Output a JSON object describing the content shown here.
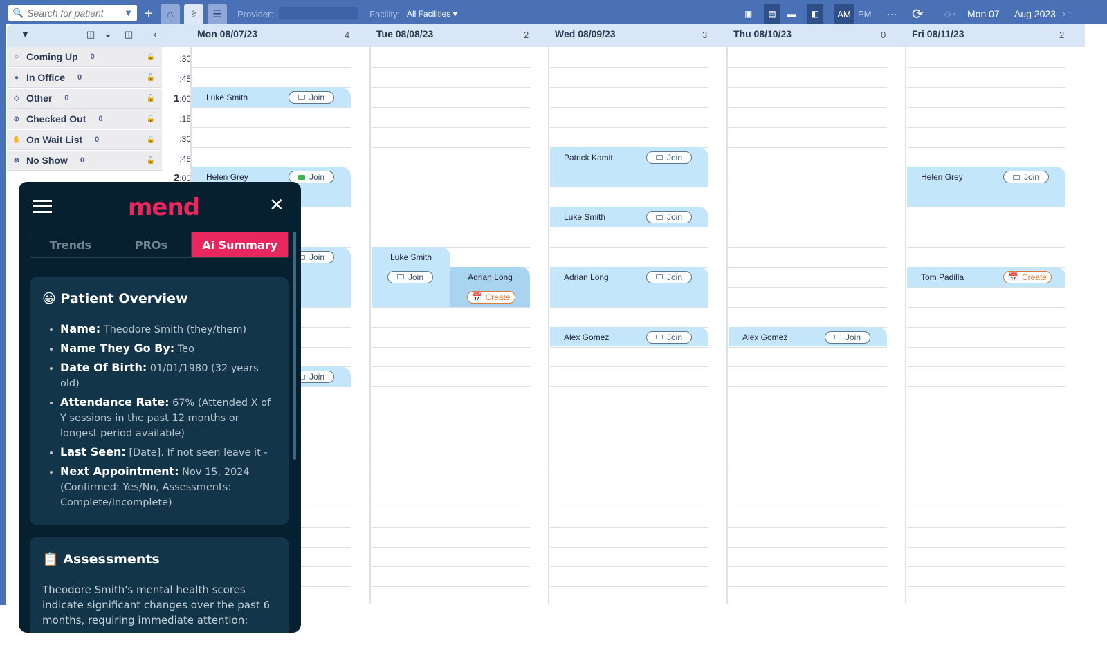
{
  "topbar": {
    "search_placeholder": "Search for patient",
    "provider_label": "Provider:",
    "facility_label": "Facility:",
    "facility_value": "All Facilities",
    "am": "AM",
    "pm": "PM",
    "more": "···",
    "date_day": "Mon 07",
    "date_month": "Aug 2023"
  },
  "days": [
    {
      "label": "Mon 08/07/23",
      "count": "4"
    },
    {
      "label": "Tue 08/08/23",
      "count": "2"
    },
    {
      "label": "Wed 08/09/23",
      "count": "3"
    },
    {
      "label": "Thu 08/10/23",
      "count": "0"
    },
    {
      "label": "Fri 08/11/23",
      "count": "2"
    }
  ],
  "statuses": [
    {
      "label": "Coming Up",
      "count": "0",
      "icon": "circle-outline"
    },
    {
      "label": "In Office",
      "count": "0",
      "icon": "circle-filled"
    },
    {
      "label": "Other",
      "count": "0",
      "icon": "diamond-outline"
    },
    {
      "label": "Checked Out",
      "count": "0",
      "icon": "check-circle"
    },
    {
      "label": "On Wait List",
      "count": "0",
      "icon": "hand"
    },
    {
      "label": "No Show",
      "count": "0",
      "icon": "x-circle"
    }
  ],
  "time_labels": [
    {
      "hour": "",
      "min": ":30"
    },
    {
      "hour": "",
      "min": ":45"
    },
    {
      "hour": "1",
      "min": ":00"
    },
    {
      "hour": "",
      "min": ":15"
    },
    {
      "hour": "",
      "min": ":30"
    },
    {
      "hour": "",
      "min": ":45"
    },
    {
      "hour": "2",
      "min": ":00"
    }
  ],
  "events": [
    {
      "day": 0,
      "start": "1:00",
      "duration": 15,
      "name": "Luke Smith",
      "action": "Join"
    },
    {
      "day": 0,
      "start": "2:00",
      "duration": 30,
      "name": "Helen Grey",
      "action": "Join",
      "video_active": true
    },
    {
      "day": 0,
      "start": "3:00",
      "duration": 45,
      "name": "",
      "action": "Join"
    },
    {
      "day": 0,
      "start": "4:30",
      "duration": 15,
      "name": "",
      "action": "Join"
    },
    {
      "day": 1,
      "start": "3:00",
      "duration": 45,
      "name": "Luke Smith",
      "action": "Join",
      "half": "left"
    },
    {
      "day": 1,
      "start": "3:15",
      "duration": 30,
      "name": "Adrian Long",
      "action": "Create",
      "half": "right"
    },
    {
      "day": 2,
      "start": "1:45",
      "duration": 30,
      "name": "Patrick Kamit",
      "action": "Join"
    },
    {
      "day": 2,
      "start": "2:30",
      "duration": 15,
      "name": "Luke Smith",
      "action": "Join"
    },
    {
      "day": 2,
      "start": "3:15",
      "duration": 30,
      "name": "Adrian Long",
      "action": "Join"
    },
    {
      "day": 2,
      "start": "4:00",
      "duration": 15,
      "name": "Alex Gomez",
      "action": "Join"
    },
    {
      "day": 3,
      "start": "4:00",
      "duration": 15,
      "name": "Alex Gomez",
      "action": "Join"
    },
    {
      "day": 4,
      "start": "2:00",
      "duration": 30,
      "name": "Helen Grey",
      "action": "Join"
    },
    {
      "day": 4,
      "start": "3:15",
      "duration": 15,
      "name": "Tom Padilla",
      "action": "Create"
    }
  ],
  "panel": {
    "logo": "mend",
    "tabs": [
      "Trends",
      "PROs",
      "Ai Summary"
    ],
    "active_tab": "Ai Summary",
    "overview": {
      "title": "Patient Overview",
      "items": [
        {
          "k": "Name:",
          "v": "Theodore Smith (they/them)"
        },
        {
          "k": "Name They Go By:",
          "v": "Teo"
        },
        {
          "k": "Date Of Birth:",
          "v": "01/01/1980 (32 years old)"
        },
        {
          "k": "Attendance Rate:",
          "v": "67% (Attended X of Y sessions in the past 12 months or longest period available)"
        },
        {
          "k": "Last Seen:",
          "v": "[Date]. If not seen leave it -"
        },
        {
          "k": "Next Appointment:",
          "v": "Nov 15, 2024 (Confirmed: Yes/No, Assessments: Complete/Incomplete)"
        }
      ]
    },
    "assessments": {
      "title": "Assessments",
      "text": "Theodore Smith's mental health scores indicate significant changes over the past 6 months, requiring immediate attention:"
    }
  },
  "colors": {
    "topbar": "#4a70b5",
    "event": "#c4e6fb",
    "brand": "#e8275e",
    "panel": "#06202f",
    "create": "#e0783a"
  }
}
